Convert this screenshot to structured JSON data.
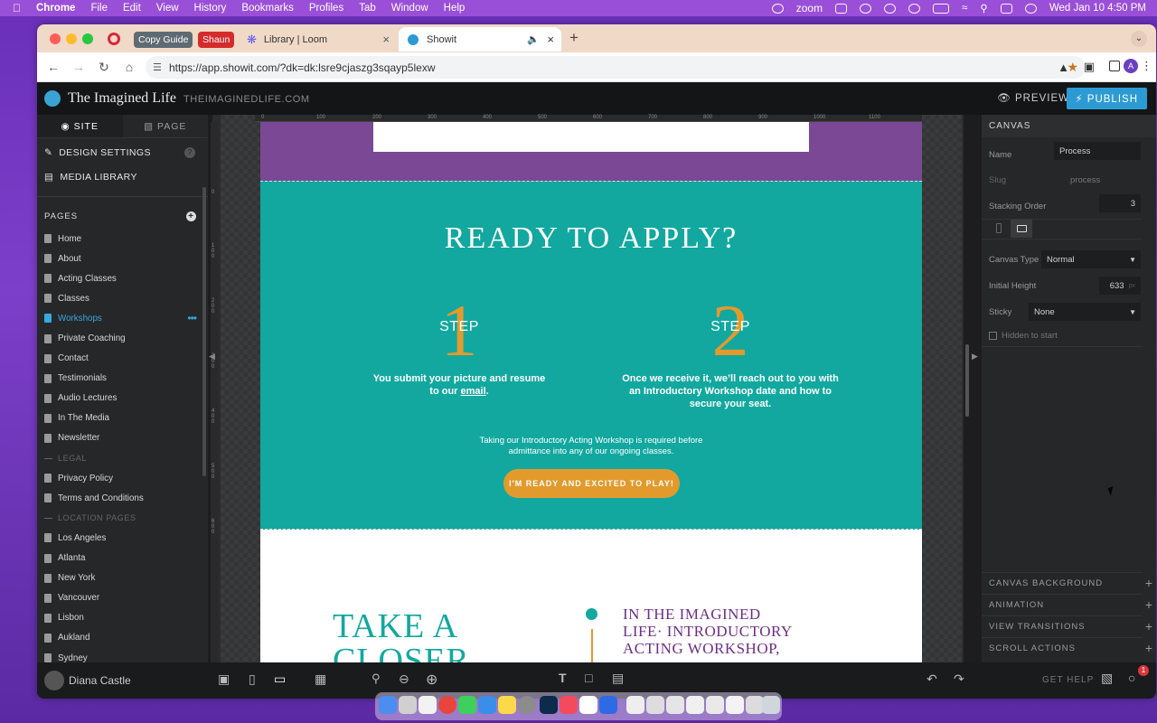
{
  "menubar": {
    "app": "Chrome",
    "items": [
      "File",
      "Edit",
      "View",
      "History",
      "Bookmarks",
      "Profiles",
      "Tab",
      "Window",
      "Help"
    ],
    "zoom": "zoom",
    "datetime": "Wed Jan 10  4:50 PM"
  },
  "tabs": {
    "copy_guide": "Copy Guide",
    "shaun": "Shaun",
    "loom_title": "Library | Loom",
    "showit_title": "Showit"
  },
  "browser": {
    "url": "https://app.showit.com/?dk=dk:lsre9cjaszg3sqayp5lexw"
  },
  "app": {
    "site_name": "The Imagined Life",
    "site_url": "THEIMAGINEDLIFE.COM",
    "preview": "PREVIEW",
    "publish": "PUBLISH"
  },
  "sidebar": {
    "tab_site": "SITE",
    "tab_page": "PAGE",
    "design_settings": "DESIGN SETTINGS",
    "media_library": "MEDIA LIBRARY",
    "pages_header": "PAGES",
    "pages": [
      {
        "label": "Home"
      },
      {
        "label": "About"
      },
      {
        "label": "Acting Classes"
      },
      {
        "label": "Classes"
      },
      {
        "label": "Workshops"
      },
      {
        "label": "Private Coaching"
      },
      {
        "label": "Contact"
      },
      {
        "label": "Testimonials"
      },
      {
        "label": "Audio Lectures"
      },
      {
        "label": "In The Media"
      },
      {
        "label": "Newsletter"
      },
      {
        "label": "LEGAL"
      },
      {
        "label": "Privacy Policy"
      },
      {
        "label": "Terms and Conditions"
      },
      {
        "label": "LOCATION PAGES"
      },
      {
        "label": "Los Angeles"
      },
      {
        "label": "Atlanta"
      },
      {
        "label": "New York"
      },
      {
        "label": "Vancouver"
      },
      {
        "label": "Lisbon"
      },
      {
        "label": "Aukland"
      },
      {
        "label": "Sydney"
      }
    ],
    "user": "Diana Castle"
  },
  "canvas": {
    "ruler": [
      "0",
      "100",
      "200",
      "300",
      "400",
      "500",
      "600",
      "700",
      "800",
      "900",
      "1000",
      "1100"
    ],
    "vruler": [
      "0",
      "1 0 0",
      "2 0 0",
      "3 0 0",
      "4 0 0",
      "5 0 0",
      "6 0 0"
    ],
    "headline": "READY TO APPLY?",
    "step1_num": "1",
    "step1_label": "STEP",
    "step1_desc_a": "You submit your picture and resume",
    "step1_desc_b": "to our",
    "step1_link": "email",
    "step1_desc_c": ".",
    "step2_num": "2",
    "step2_label": "STEP",
    "step2_desc_a": "Once we receive it, we’ll reach out to you with",
    "step2_desc_b": "an Introductory Workshop date and how to",
    "step2_desc_c": "secure your seat.",
    "note_a": "Taking our Introductory Acting Workshop is required before",
    "note_b": "admittance into any of our ongoing classes.",
    "cta": "I'M READY AND EXCITED TO PLAY!",
    "closer_a": "TAKE A",
    "closer_b": "CLOSER",
    "workshop_a": "IN THE IMAGINED",
    "workshop_b": "LIFE· INTRODUCTORY",
    "workshop_c": "ACTING WORKSHOP,"
  },
  "right_panel": {
    "header": "CANVAS",
    "name_label": "Name",
    "name_value": "Process",
    "slug_label": "Slug",
    "slug_value": "process",
    "stacking_label": "Stacking Order",
    "stacking_value": "3",
    "canvas_type_label": "Canvas Type",
    "canvas_type_value": "Normal",
    "initial_height_label": "Initial Height",
    "initial_height_value": "633",
    "initial_height_unit": "px",
    "sticky_label": "Sticky",
    "sticky_value": "None",
    "hidden_label": "Hidden to start",
    "sections": [
      "CANVAS BACKGROUND",
      "ANIMATION",
      "VIEW TRANSITIONS",
      "SCROLL ACTIONS"
    ]
  },
  "bottom": {
    "get_help": "GET HELP",
    "notif_count": "1"
  },
  "colors": {
    "teal": "#12a89f",
    "orange": "#e39a2d",
    "purple": "#7a4894",
    "publish_blue": "#2d9bd3"
  }
}
